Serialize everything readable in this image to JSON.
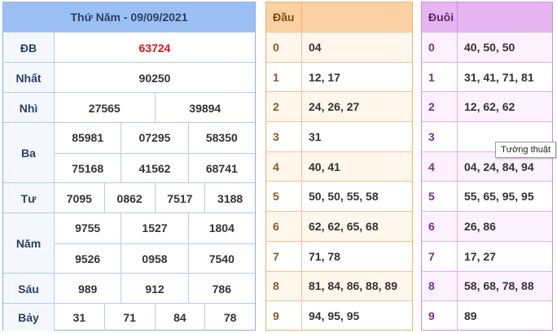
{
  "results": {
    "title": "Thứ Năm - 09/09/2021",
    "rows": [
      {
        "label": "ĐB",
        "lines": [
          [
            "63724"
          ]
        ]
      },
      {
        "label": "Nhất",
        "lines": [
          [
            "90250"
          ]
        ]
      },
      {
        "label": "Nhì",
        "lines": [
          [
            "27565",
            "39894"
          ]
        ]
      },
      {
        "label": "Ba",
        "lines": [
          [
            "85981",
            "07295",
            "58350"
          ],
          [
            "75168",
            "41562",
            "68741"
          ]
        ]
      },
      {
        "label": "Tư",
        "lines": [
          [
            "7095",
            "0862",
            "7517",
            "3188"
          ]
        ]
      },
      {
        "label": "Năm",
        "lines": [
          [
            "9755",
            "1527",
            "1804"
          ],
          [
            "9526",
            "0958",
            "7540"
          ]
        ]
      },
      {
        "label": "Sáu",
        "lines": [
          [
            "989",
            "912",
            "786"
          ]
        ]
      },
      {
        "label": "Bảy",
        "lines": [
          [
            "31",
            "71",
            "84",
            "78"
          ]
        ]
      }
    ]
  },
  "dau": {
    "header": "Đầu",
    "rows": [
      {
        "digit": "0",
        "values": "04"
      },
      {
        "digit": "1",
        "values": "12, 17"
      },
      {
        "digit": "2",
        "values": "24, 26, 27"
      },
      {
        "digit": "3",
        "values": "31"
      },
      {
        "digit": "4",
        "values": "40, 41"
      },
      {
        "digit": "5",
        "values": "50, 50, 55, 58"
      },
      {
        "digit": "6",
        "values": "62, 62, 65, 68"
      },
      {
        "digit": "7",
        "values": "71, 78"
      },
      {
        "digit": "8",
        "values": "81, 84, 86, 88, 89"
      },
      {
        "digit": "9",
        "values": "94, 95, 95"
      }
    ]
  },
  "duoi": {
    "header": "Đuôi",
    "rows": [
      {
        "digit": "0",
        "values": "40, 50, 50"
      },
      {
        "digit": "1",
        "values": "31, 41, 71, 81"
      },
      {
        "digit": "2",
        "values": "12, 62, 62"
      },
      {
        "digit": "3",
        "values": ""
      },
      {
        "digit": "4",
        "values": "04, 24, 84, 94"
      },
      {
        "digit": "5",
        "values": "55, 65, 95, 95"
      },
      {
        "digit": "6",
        "values": "26, 86"
      },
      {
        "digit": "7",
        "values": "17, 27"
      },
      {
        "digit": "8",
        "values": "58, 68, 78, 88"
      },
      {
        "digit": "9",
        "values": "89"
      }
    ]
  },
  "tooltip": "Tường thuật",
  "colors": {
    "special_prize": "#e0121b",
    "results_header": "#9bbff2",
    "dau_header": "#fbd1a4",
    "duoi_header": "#e5b5ef"
  }
}
